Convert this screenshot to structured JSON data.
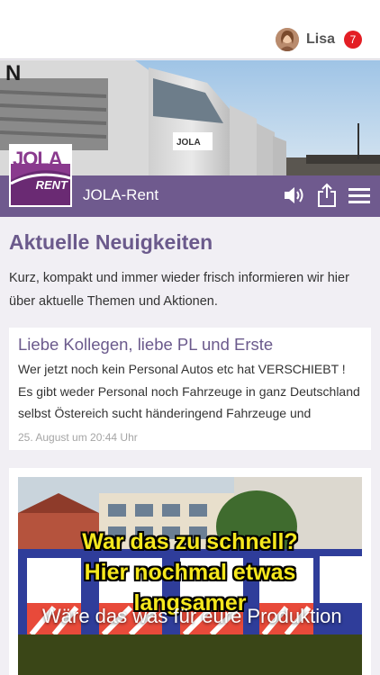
{
  "header": {
    "user_name": "Lisa",
    "notification_count": "7"
  },
  "brand": {
    "name": "JOLA-Rent",
    "logo_text_top": "JOLA",
    "logo_text_bottom": "RENT"
  },
  "toolbar": {
    "icons": [
      "speaker-icon",
      "share-icon",
      "menu-icon"
    ]
  },
  "news": {
    "title": "Aktuelle Neuigkeiten",
    "subtitle": "Kurz, kompakt und immer wieder frisch informieren wir hier über aktuelle Themen und Aktionen."
  },
  "post": {
    "title": "Liebe Kollegen, liebe PL und Erste",
    "body": "Wer jetzt noch kein Personal Autos etc hat VERSCHIEBT ! Es gibt weder Personal noch Fahrzeuge in ganz Deutschland selbst Östereich sucht händeringend Fahrzeuge und",
    "date": "25. August um 20:44 Uhr"
  },
  "media_post": {
    "overlay_line1": "War das zu schnell?",
    "overlay_line2": "Hier nochmal etwas",
    "overlay_line3": "langsamer",
    "caption": "Wäre das was für eure Produktion"
  },
  "colors": {
    "brand_purple": "#6f5a8e",
    "title_purple": "#6b5a8c",
    "badge_red": "#e31e24",
    "overlay_yellow": "#f6e81d"
  }
}
